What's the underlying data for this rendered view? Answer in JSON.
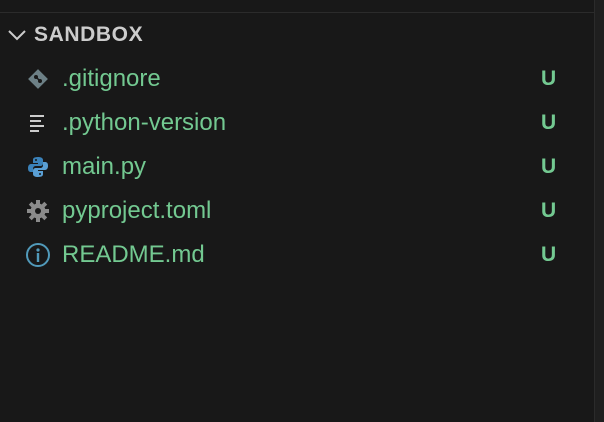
{
  "explorer": {
    "section_title": "SANDBOX",
    "files": [
      {
        "name": ".gitignore",
        "status": "U",
        "icon": "git-icon",
        "icon_color": "#6d8086"
      },
      {
        "name": ".python-version",
        "status": "U",
        "icon": "text-file-icon",
        "icon_color": "#cccccc"
      },
      {
        "name": "main.py",
        "status": "U",
        "icon": "python-icon",
        "icon_color": "#3b82b9"
      },
      {
        "name": "pyproject.toml",
        "status": "U",
        "icon": "gear-icon",
        "icon_color": "#8b8b8b"
      },
      {
        "name": "README.md",
        "status": "U",
        "icon": "info-icon",
        "icon_color": "#519aba"
      }
    ]
  },
  "colors": {
    "background": "#181818",
    "untracked_text": "#73c991",
    "header_text": "#cccccc"
  }
}
